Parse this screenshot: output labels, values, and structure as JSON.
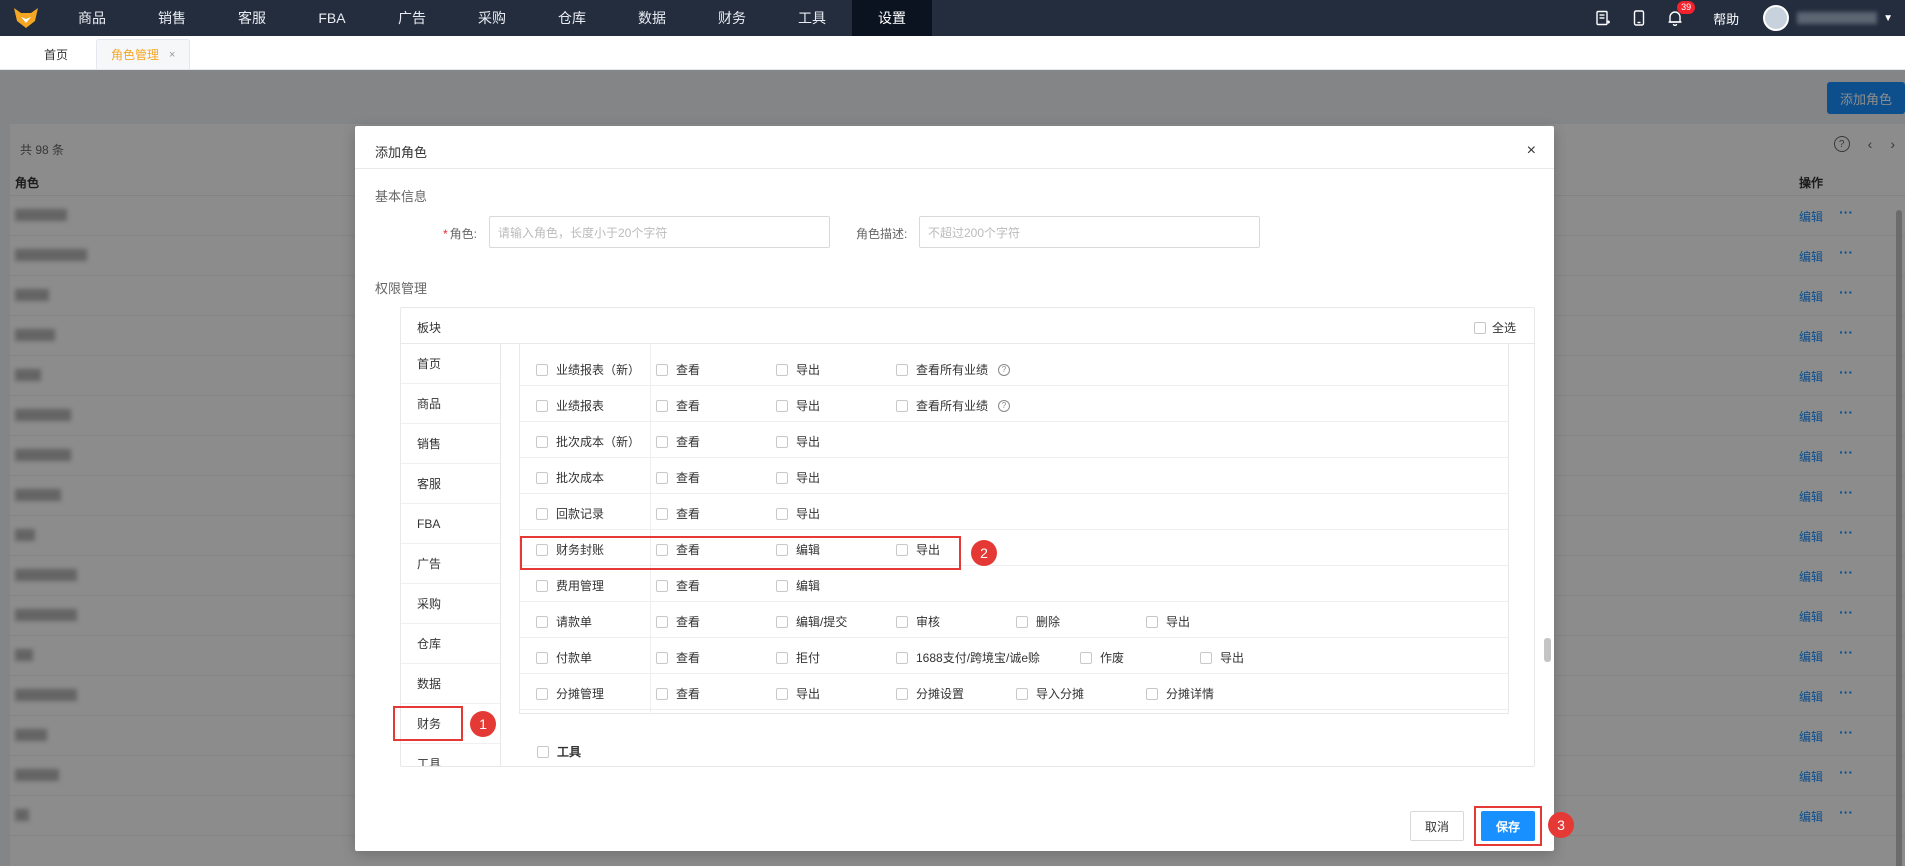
{
  "topnav": {
    "items": [
      "商品",
      "销售",
      "客服",
      "FBA",
      "广告",
      "采购",
      "仓库",
      "数据",
      "财务",
      "工具",
      "设置"
    ],
    "active_index": 10,
    "notification_count": "39",
    "help": "帮助"
  },
  "tabs": {
    "home": "首页",
    "role_mgmt": "角色管理",
    "close": "×"
  },
  "bg": {
    "add_role": "添加角色",
    "count": "共 98 条",
    "col_role": "角色",
    "col_ops": "操作",
    "edit": "编辑",
    "more": "···",
    "help_mark": "?",
    "prev": "‹",
    "next": "›"
  },
  "modal": {
    "title": "添加角色",
    "close": "×",
    "basic_info": "基本信息",
    "role_label": "角色:",
    "required_mark": "*",
    "role_placeholder": "请输入角色，长度小于20个字符",
    "desc_label": "角色描述:",
    "desc_placeholder": "不超过200个字符",
    "perm_title": "权限管理",
    "module_header": "板块",
    "select_all": "全选",
    "modules": [
      "首页",
      "商品",
      "销售",
      "客服",
      "FBA",
      "广告",
      "采购",
      "仓库",
      "数据",
      "财务",
      "工具"
    ],
    "rows": [
      {
        "name": "业绩报表（新）",
        "perms": [
          "查看",
          "导出",
          "查看所有业绩"
        ],
        "help_on_last": true
      },
      {
        "name": "业绩报表",
        "perms": [
          "查看",
          "导出",
          "查看所有业绩"
        ],
        "help_on_last": true
      },
      {
        "name": "批次成本（新）",
        "perms": [
          "查看",
          "导出"
        ]
      },
      {
        "name": "批次成本",
        "perms": [
          "查看",
          "导出"
        ]
      },
      {
        "name": "回款记录",
        "perms": [
          "查看",
          "导出"
        ]
      },
      {
        "name": "财务封账",
        "perms": [
          "查看",
          "编辑",
          "导出"
        ]
      },
      {
        "name": "费用管理",
        "perms": [
          "查看",
          "编辑"
        ]
      },
      {
        "name": "请款单",
        "perms": [
          "查看",
          "编辑/提交",
          "审核",
          "删除",
          "导出"
        ]
      },
      {
        "name": "付款单",
        "perms": [
          "查看",
          "拒付",
          "1688支付/跨境宝/诚e赊",
          "作废",
          "导出"
        ]
      },
      {
        "name": "分摊管理",
        "perms": [
          "查看",
          "导出",
          "分摊设置",
          "导入分摊",
          "分摊详情"
        ]
      }
    ],
    "tool_section": "工具",
    "cancel": "取消",
    "save": "保存"
  },
  "annotations": [
    "1",
    "2",
    "3"
  ],
  "colors": {
    "nav_bg": "#232d3d",
    "primary": "#1890ff",
    "annotation": "#e53935"
  }
}
